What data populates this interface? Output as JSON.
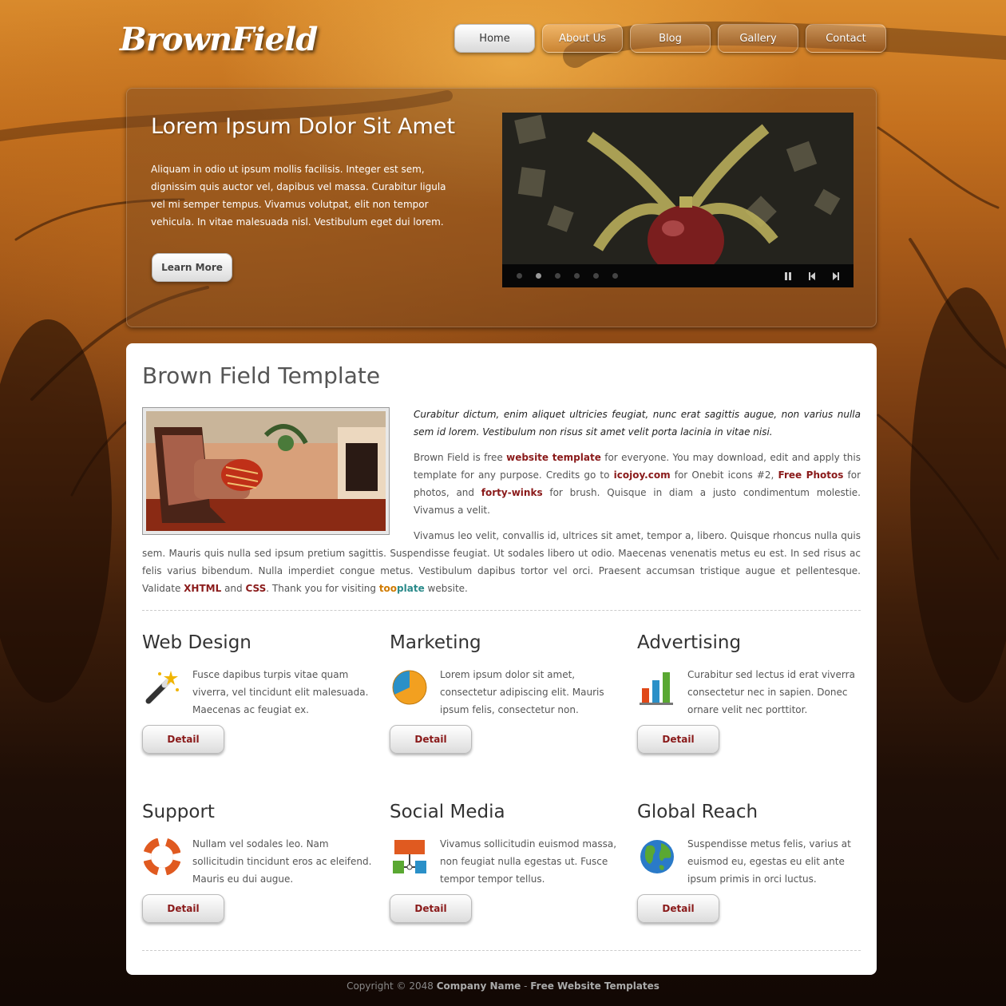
{
  "site": {
    "logo": "BrownField"
  },
  "nav": [
    {
      "label": "Home",
      "active": true
    },
    {
      "label": "About Us"
    },
    {
      "label": "Blog"
    },
    {
      "label": "Gallery"
    },
    {
      "label": "Contact"
    }
  ],
  "hero": {
    "title": "Lorem Ipsum Dolor Sit Amet",
    "text": "Aliquam in odio ut ipsum mollis facilisis. Integer est sem, dignissim quis auctor vel, dapibus vel massa. Curabitur ligula vel mi semper tempus. Vivamus volutpat, elit non tempor vehicula. In vitae malesuada nisl. Vestibulum eget dui lorem.",
    "button": "Learn More",
    "slider_dots": 6,
    "active_dot": 2
  },
  "main": {
    "title": "Brown Field Template",
    "lead": "Curabitur dictum, enim aliquet ultricies feugiat, nunc erat sagittis augue, non varius nulla sem id lorem. Vestibulum non risus sit amet velit porta lacinia in vitae nisi.",
    "p2": {
      "t1": "Brown Field is free ",
      "l1": "website template",
      "t2": " for everyone. You may download, edit and apply this template for any purpose. Credits go to ",
      "l2": "icojoy.com",
      "t3": " for Onebit icons #2, ",
      "l3": "Free Photos",
      "t4": " for photos, and ",
      "l4": "forty-winks",
      "t5": " for brush. Quisque in diam a justo condimentum molestie. Vivamus a velit."
    },
    "p3": {
      "t1": "Vivamus leo velit, convallis id, ultrices sit amet, tempor a, libero. Quisque rhoncus nulla quis sem. Mauris quis nulla sed ipsum pretium sagittis. Suspendisse feugiat. Ut sodales libero ut odio. Maecenas venenatis metus eu est. In sed risus ac felis varius bibendum. Nulla imperdiet congue metus. Vestibulum dapibus tortor vel orci. Praesent accumsan tristique augue et pellentesque. Validate ",
      "l1": "XHTML",
      "t2": " and ",
      "l2": "CSS",
      "t3": ". Thank you for visiting ",
      "l3a": "too",
      "l3b": "plate",
      "t4": " website."
    }
  },
  "services": [
    {
      "title": "Web Design",
      "icon": "magic-wand-icon",
      "text": "Fusce dapibus turpis vitae quam viverra, vel tincidunt elit malesuada. Maecenas ac feugiat ex.",
      "button": "Detail"
    },
    {
      "title": "Marketing",
      "icon": "pie-chart-icon",
      "text": "Lorem ipsum dolor sit amet, consectetur adipiscing elit. Mauris ipsum felis, consectetur non.",
      "button": "Detail"
    },
    {
      "title": "Advertising",
      "icon": "bar-chart-icon",
      "text": "Curabitur sed lectus id erat viverra consectetur nec in sapien. Donec ornare velit nec porttitor.",
      "button": "Detail"
    },
    {
      "title": "Support",
      "icon": "lifebuoy-icon",
      "text": "Nullam vel sodales leo. Nam sollicitudin tincidunt eros ac eleifend. Mauris eu dui augue.",
      "button": "Detail"
    },
    {
      "title": "Social Media",
      "icon": "network-icon",
      "text": "Vivamus sollicitudin euismod massa, non feugiat nulla egestas ut. Fusce tempor tempor tellus.",
      "button": "Detail"
    },
    {
      "title": "Global Reach",
      "icon": "globe-icon",
      "text": "Suspendisse metus felis, varius at euismod eu, egestas eu elit ante ipsum primis in orci luctus.",
      "button": "Detail"
    }
  ],
  "footer": {
    "prefix": "Copyright © 2048 ",
    "company": "Company Name",
    "sep": " - ",
    "link": "Free Website Templates"
  }
}
